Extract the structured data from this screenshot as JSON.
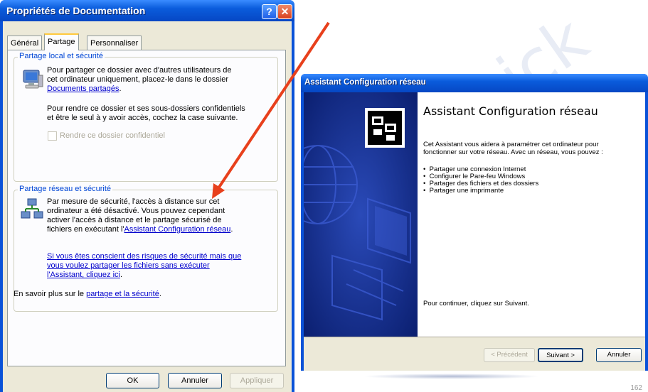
{
  "watermark": "ick",
  "dialog1": {
    "title": "Propriétés de Documentation",
    "help_glyph": "?",
    "close_glyph": "✕",
    "tabs": [
      {
        "label": "Général"
      },
      {
        "label": "Partage"
      },
      {
        "label": "Personnaliser"
      }
    ],
    "local_group": {
      "legend": "Partage local et sécurité",
      "p1_line1": "Pour partager ce dossier avec d'autres utilisateurs de",
      "p1_line2": "cet ordinateur uniquement, placez-le dans le dossier",
      "p1_link": "Documents partagés",
      "p1_end": ".",
      "p2_line1": "Pour rendre ce dossier et ses sous-dossiers confidentiels",
      "p2_line2": "et être le seul à y avoir accès, cochez la case suivante.",
      "checkbox_label": "Rendre ce dossier confidentiel"
    },
    "network_group": {
      "legend": "Partage réseau et sécurité",
      "p1_line1": "Par mesure de sécurité, l'accès à distance sur cet",
      "p1_line2": "ordinateur a été désactivé. Vous pouvez cependant",
      "p1_line3": "activer l'accès à distance et le partage sécurisé de",
      "p1_line4a": "fichiers en exécutant l'",
      "p1_link": "Assistant Configuration réseau",
      "p1_end": ".",
      "link2_line1": "Si vous êtes conscient des risques de sécurité mais que",
      "link2_line2": "vous voulez partager les fichiers sans exécuter",
      "link2_line3": "l'Assistant, cliquez ici",
      "link2_end": "."
    },
    "learn_more_prefix": "En savoir plus sur le ",
    "learn_more_link": "partage et la sécurité",
    "learn_more_end": ".",
    "buttons": {
      "ok": "OK",
      "cancel": "Annuler",
      "apply": "Appliquer"
    }
  },
  "dialog2": {
    "title": "Assistant Configuration réseau",
    "heading": "Assistant Configuration réseau",
    "intro_line1": "Cet Assistant vous aidera à paramétrer cet ordinateur pour",
    "intro_line2": "fonctionner sur votre réseau. Avec un réseau, vous pouvez :",
    "bullets": [
      "Partager une connexion Internet",
      "Configurer le Pare-feu Windows",
      "Partager des fichiers et des dossiers",
      "Partager une imprimante"
    ],
    "continue_text": "Pour continuer, cliquez sur Suivant.",
    "buttons": {
      "prev": "< Précédent",
      "next": "Suivant >",
      "cancel": "Annuler"
    }
  },
  "page_number": "162",
  "colors": {
    "arrow": "#e8401c",
    "link": "#0000cc",
    "xp_blue": "#0a52d8"
  }
}
